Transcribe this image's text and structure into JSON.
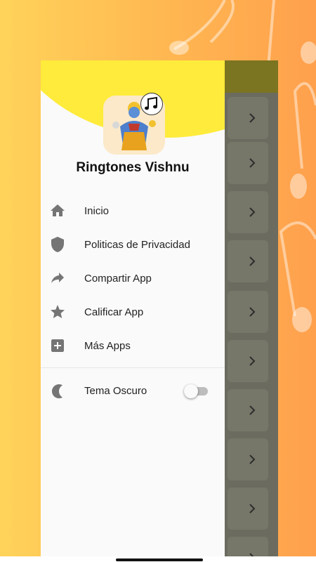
{
  "drawer": {
    "app_title": "Ringtones Vishnu",
    "menu": [
      {
        "label": "Inicio",
        "icon": "home-icon"
      },
      {
        "label": "Politicas de Privacidad",
        "icon": "shield-icon"
      },
      {
        "label": "Compartir App",
        "icon": "share-icon"
      },
      {
        "label": "Calificar App",
        "icon": "star-icon"
      },
      {
        "label": "Más Apps",
        "icon": "add-box-icon"
      }
    ],
    "theme": {
      "label": "Tema Oscuro",
      "icon": "moon-icon",
      "enabled": false
    }
  },
  "colors": {
    "accent_yellow": "#ffeb3b",
    "background_left": "#ffd35a",
    "background_right": "#ffa04d",
    "icon_gray": "#757575"
  }
}
